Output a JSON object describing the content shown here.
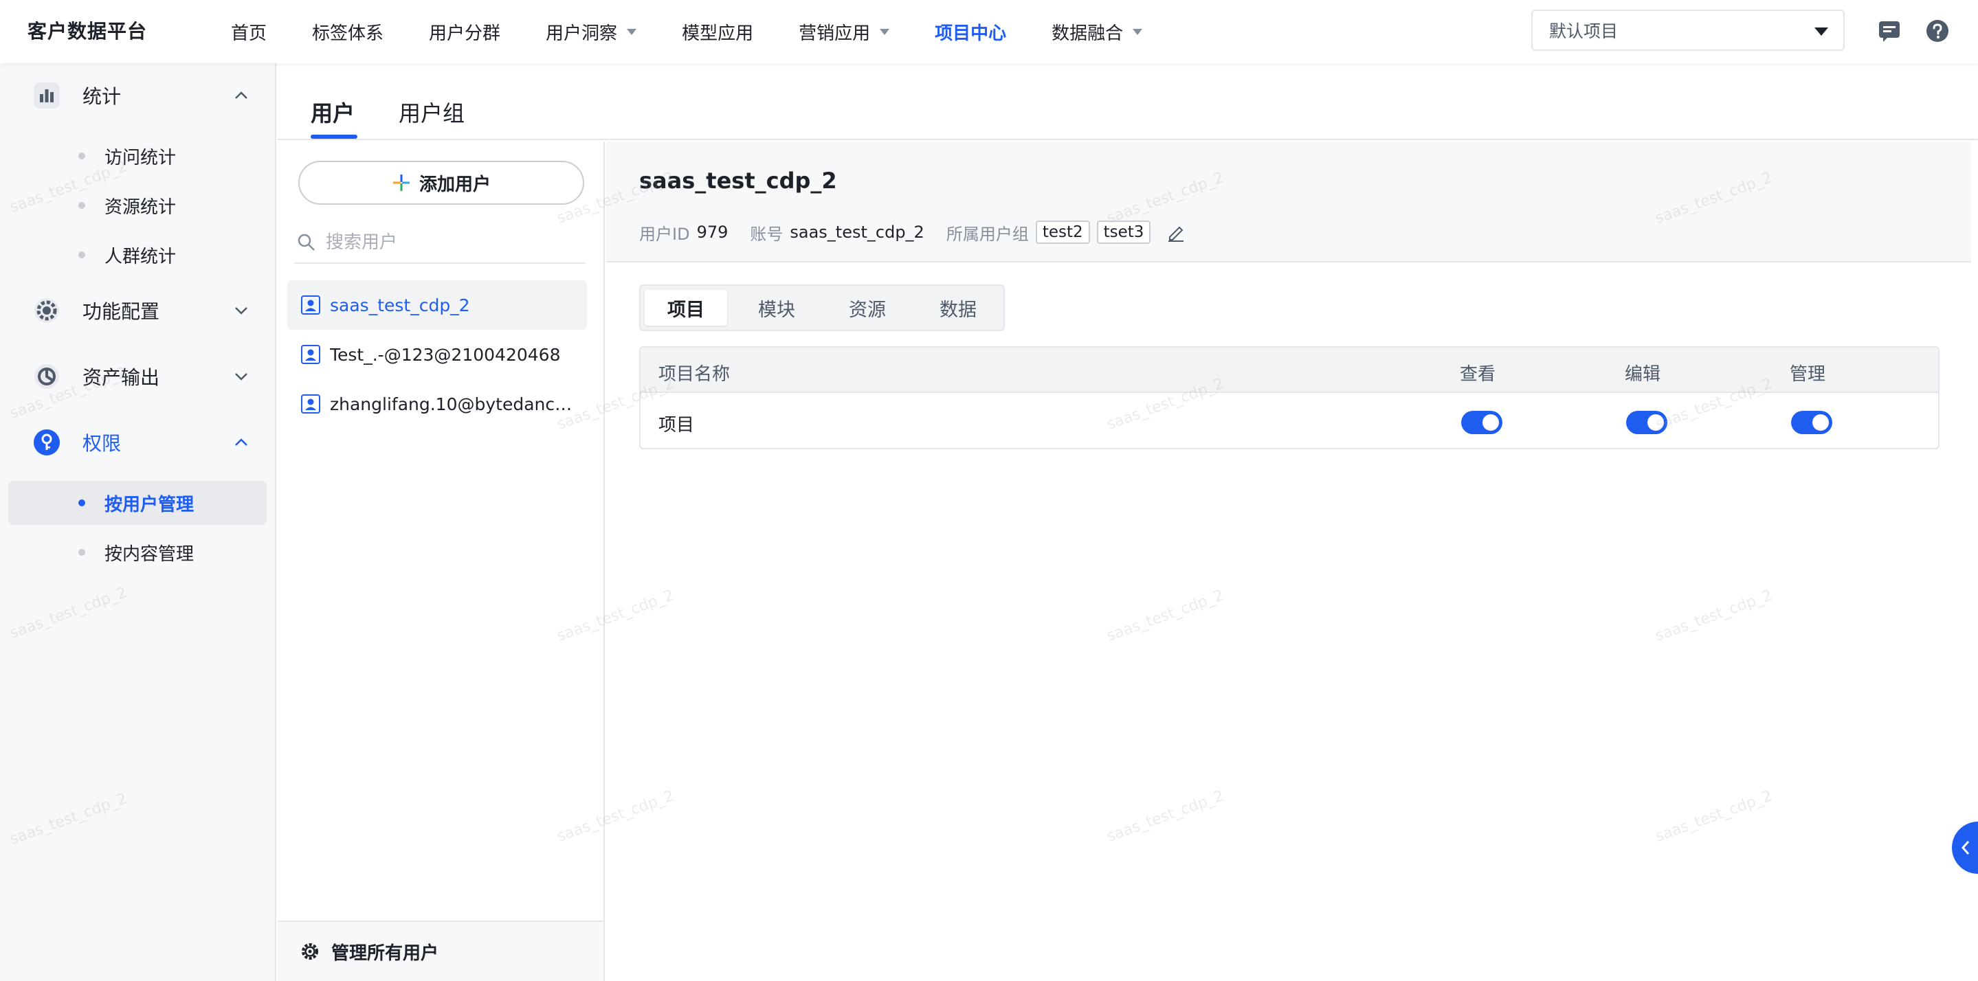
{
  "header": {
    "brand": "客户数据平台",
    "nav": [
      {
        "label": "首页",
        "dropdown": false,
        "active": false
      },
      {
        "label": "标签体系",
        "dropdown": false,
        "active": false
      },
      {
        "label": "用户分群",
        "dropdown": false,
        "active": false
      },
      {
        "label": "用户洞察",
        "dropdown": true,
        "active": false
      },
      {
        "label": "模型应用",
        "dropdown": false,
        "active": false
      },
      {
        "label": "营销应用",
        "dropdown": true,
        "active": false
      },
      {
        "label": "项目中心",
        "dropdown": false,
        "active": true
      },
      {
        "label": "数据融合",
        "dropdown": true,
        "active": false
      }
    ],
    "project_select": "默认项目",
    "icons": [
      "message-icon",
      "help-icon"
    ]
  },
  "sidebar": {
    "groups": [
      {
        "label": "统计",
        "icon": "bar-chart-icon",
        "expanded": true,
        "items": [
          "访问统计",
          "资源统计",
          "人群统计"
        ]
      },
      {
        "label": "功能配置",
        "icon": "gear-icon",
        "expanded": false,
        "items": []
      },
      {
        "label": "资产输出",
        "icon": "asset-export-icon",
        "expanded": false,
        "items": []
      },
      {
        "label": "权限",
        "icon": "permission-key-icon",
        "expanded": true,
        "active": true,
        "items": [
          "按用户管理",
          "按内容管理"
        ],
        "active_item": "按用户管理"
      }
    ]
  },
  "main": {
    "tabs": [
      "用户",
      "用户组"
    ],
    "active_tab": "用户"
  },
  "user_list": {
    "add_button": "添加用户",
    "search_placeholder": "搜索用户",
    "users": [
      "saas_test_cdp_2",
      "Test_.-@123@2100420468",
      "zhanglifang.10@bytedance...."
    ],
    "selected": "saas_test_cdp_2",
    "footer": "管理所有用户"
  },
  "detail": {
    "title": "saas_test_cdp_2",
    "user_id_label": "用户ID",
    "user_id": "979",
    "account_label": "账号",
    "account": "saas_test_cdp_2",
    "groups_label": "所属用户组",
    "groups": [
      "test2",
      "tset3"
    ],
    "segments": [
      "项目",
      "模块",
      "资源",
      "数据"
    ],
    "active_segment": "项目",
    "table": {
      "headers": [
        "项目名称",
        "查看",
        "编辑",
        "管理"
      ],
      "rows": [
        {
          "name": "项目",
          "view": true,
          "edit": true,
          "manage": true
        }
      ]
    }
  },
  "watermark": "saas_test_cdp_2",
  "colors": {
    "accent": "#1f5cf0",
    "text": "#1d2129",
    "muted": "#86909c",
    "border": "#e5e6eb"
  }
}
